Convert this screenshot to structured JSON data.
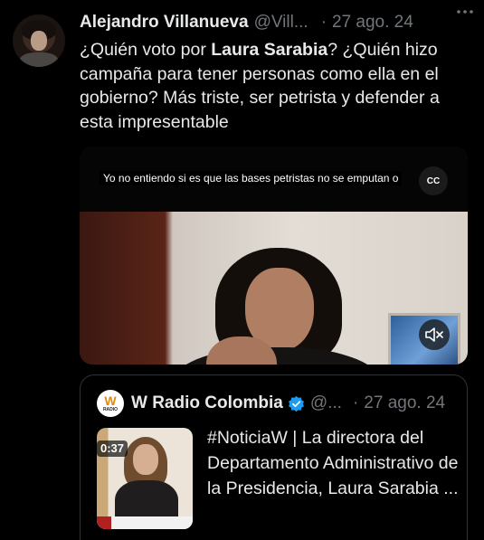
{
  "tweet": {
    "author_name": "Alejandro Villanueva",
    "author_handle": "@Vill...",
    "separator": "·",
    "date": "27 ago. 24",
    "more_icon": "more-options-icon",
    "text_parts": [
      {
        "text": "¿Quién voto por ",
        "bold": false
      },
      {
        "text": "Laura Sarabia",
        "bold": true
      },
      {
        "text": "? ¿Quién hizo campaña para tener personas como ella en el gobierno?  Más triste, ser petrista y defender a esta impresentable",
        "bold": false
      }
    ]
  },
  "video": {
    "caption": "Yo no entiendo si es que las bases petristas no se emputan o",
    "cc_label": "CC",
    "mute_icon": "volume-muted-icon"
  },
  "quote": {
    "logo_text": "W",
    "logo_subtext": "RADIO",
    "author_name": "W Radio Colombia",
    "verified_icon": "verified-badge-icon",
    "verified_color": "#1d9bf0",
    "author_handle": "@...",
    "separator": "·",
    "date": "27 ago. 24",
    "text": "#NoticiaW | La directora del Departamento Administrativo de la Presidencia, Laura Sarabia ...",
    "video_duration": "0:37"
  },
  "colors": {
    "background": "#000000",
    "text_primary": "#e7e9ea",
    "text_secondary": "#71767b",
    "border": "#2f3336"
  }
}
